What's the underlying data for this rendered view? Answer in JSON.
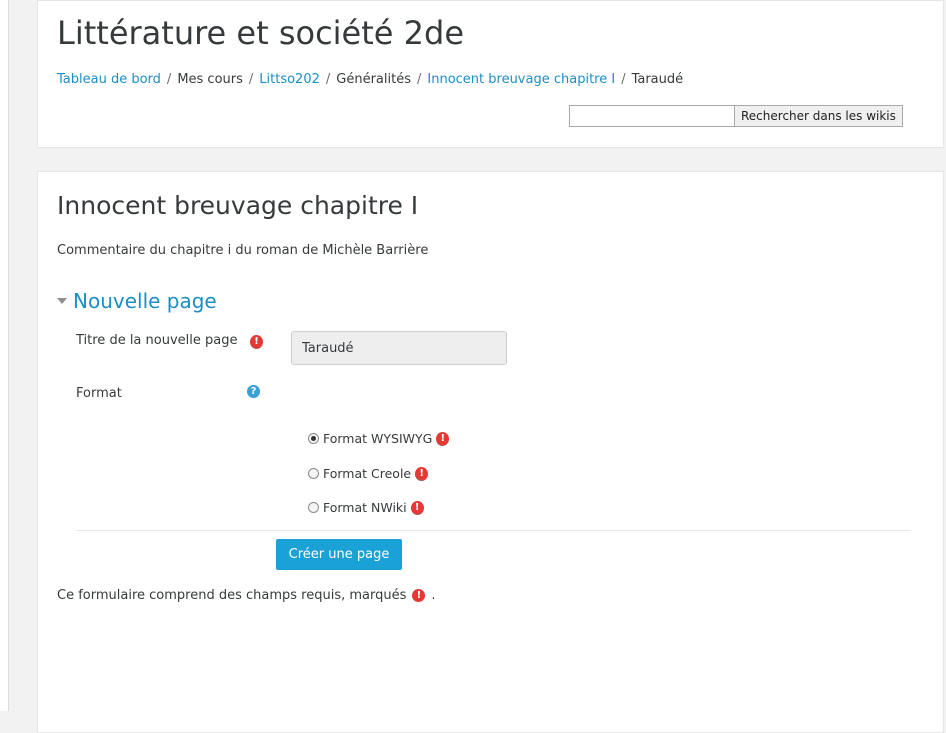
{
  "course": {
    "title": "Littérature et société 2de"
  },
  "breadcrumb": {
    "items": [
      {
        "label": "Tableau de bord",
        "link": true
      },
      {
        "label": "Mes cours",
        "link": false
      },
      {
        "label": "Littso202",
        "link": true
      },
      {
        "label": "Généralités",
        "link": false
      },
      {
        "label": "Innocent breuvage chapitre I",
        "link": true
      },
      {
        "label": "Taraudé",
        "link": false
      }
    ],
    "separator": "/"
  },
  "search": {
    "value": "",
    "button_label": "Rechercher dans les wikis"
  },
  "wiki": {
    "title": "Innocent breuvage chapitre I",
    "description": "Commentaire du chapitre i du roman de Michèle Barrière"
  },
  "form": {
    "section_label": "Nouvelle page",
    "page_title_label": "Titre de la nouvelle page",
    "page_title_value": "Taraudé",
    "format_label": "Format",
    "format_options": [
      {
        "label": "Format WYSIWYG",
        "checked": true
      },
      {
        "label": "Format Creole",
        "checked": false
      },
      {
        "label": "Format NWiki",
        "checked": false
      }
    ],
    "submit_label": "Créer une page",
    "required_note": "Ce formulaire comprend des champs requis, marqués",
    "required_note_end": "."
  },
  "icons": {
    "required": "exclamation-circle-icon",
    "help": "question-circle-icon",
    "collapse": "caret-down-icon"
  },
  "colors": {
    "link": "#1d8ec4",
    "primary_button": "#1aa2d6",
    "required": "#e53935",
    "help": "#3aa0d8"
  }
}
